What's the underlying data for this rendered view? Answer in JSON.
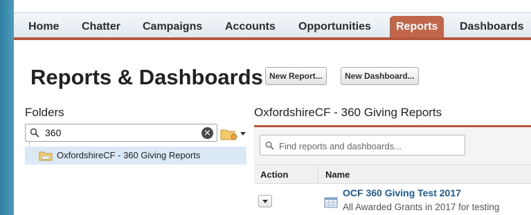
{
  "nav": {
    "tabs": [
      {
        "label": "Home",
        "active": false
      },
      {
        "label": "Chatter",
        "active": false
      },
      {
        "label": "Campaigns",
        "active": false
      },
      {
        "label": "Accounts",
        "active": false
      },
      {
        "label": "Opportunities",
        "active": false
      },
      {
        "label": "Reports",
        "active": true
      },
      {
        "label": "Dashboards",
        "active": false
      }
    ]
  },
  "header": {
    "title": "Reports & Dashboards",
    "new_report_label": "New Report...",
    "new_dashboard_label": "New Dashboard..."
  },
  "folders": {
    "label": "Folders",
    "search_value": "360",
    "selected_folder": "OxfordshireCF - 360 Giving Reports"
  },
  "main": {
    "title": "OxfordshireCF - 360 Giving Reports",
    "search_placeholder": "Find reports and dashboards...",
    "columns": {
      "action": "Action",
      "name": "Name"
    },
    "rows": [
      {
        "name": "OCF 360 Giving Test 2017",
        "description": "All Awarded Grants in 2017 for testing"
      }
    ]
  },
  "icons": {
    "search": "magnifier-icon",
    "clear": "clear-x-icon",
    "folder": "folder-icon",
    "folder_menu": "folder-gear-icon",
    "report": "report-table-icon",
    "action": "chevron-down-icon"
  },
  "colors": {
    "accent": "#b5583f",
    "active_tab": "#c1654b",
    "link": "#1d5a93",
    "selection": "#dbe9f6"
  }
}
